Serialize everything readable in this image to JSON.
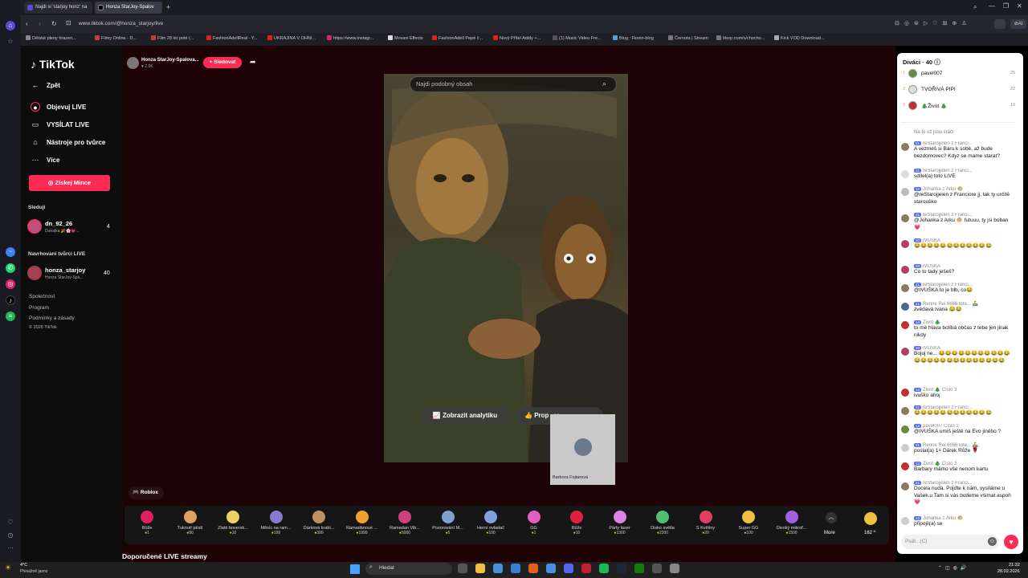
{
  "browser": {
    "tabs": [
      {
        "label": "Najdi si 'starjoy honz' na"
      },
      {
        "label": "Honza StarJoy-Spalov"
      }
    ],
    "url": "www.tiktok.com/@honza_starjoy/live",
    "bookmarks": [
      "Dětské pleny hrazen...",
      "Filmy Online - D...",
      "Film 28 let poté (...",
      "FashionAdellReal - Y...",
      "UKRAJINA V OHNI...",
      "https://www.instagr...",
      "Movavi Effects",
      "FashionAdell Pepé č...",
      "Nový Přítel Adély +...",
      "(1) Music Video Fre...",
      "Blog : Fionin-blog",
      "Černota | Stream",
      "blerp.com/s/chocho...",
      "Kick VOD Download..."
    ]
  },
  "nav": {
    "logo": "TikTok",
    "back": "Zpět",
    "items": [
      "Objevuj LIVE",
      "VYSÍLAT LIVE",
      "Nástroje pro tvůrce",
      "Více"
    ],
    "coins_button": "Získej Mince",
    "following_title": "Sleduji",
    "following": {
      "name": "dn_92_26",
      "sub": "Dunajka 🎉🌸💗...",
      "count": "4"
    },
    "suggested_title": "Navrhovaní tvůrci LIVE",
    "suggested": {
      "name": "honza_starjoy",
      "sub": "Honza StarJoy-Spa...",
      "count": "40"
    },
    "footer": [
      "Společnost",
      "Program",
      "Podmínky a zásady",
      "© 2026 TikTok"
    ]
  },
  "stream": {
    "host": "Honza StarJoy-Spalova...",
    "likes": "2.5K",
    "follow": "+ Sledovat",
    "search_placeholder": "Najdi podobný obsah",
    "analytics": "Zobrazit analytiku",
    "prop": "Prop",
    "prop_count": "14",
    "cam_name": "Barbora Fojtarová",
    "category": "Roblox"
  },
  "gifts": [
    {
      "name": "Růže",
      "price": "1",
      "color": "#e02060"
    },
    {
      "name": "Ťuknutí pěstí",
      "price": "90",
      "color": "#e0a060"
    },
    {
      "name": "Zlaté boxersk...",
      "price": "10",
      "color": "#f0d060"
    },
    {
      "name": "Měsíc na ram...",
      "price": "199",
      "color": "#8a7ad0"
    },
    {
      "name": "Dárková krabi...",
      "price": "399",
      "color": "#c09060"
    },
    {
      "name": "Ramadánové ...",
      "price": "1999",
      "color": "#f0a030"
    },
    {
      "name": "Ramadan Vib...",
      "price": "5000",
      "color": "#d04080"
    },
    {
      "name": "Pozorování M...",
      "price": "5",
      "color": "#80a0d0"
    },
    {
      "name": "Herní ovladač",
      "price": "100",
      "color": "#80a0e0"
    },
    {
      "name": "GG",
      "price": "1",
      "color": "#e060c0"
    },
    {
      "name": "Růže",
      "price": "10",
      "color": "#e02040"
    },
    {
      "name": "Párty laser",
      "price": "1300",
      "color": "#e080e0"
    },
    {
      "name": "Disko světla",
      "price": "2200",
      "color": "#50c070"
    },
    {
      "name": "S Květiny",
      "price": "20",
      "color": "#e04060"
    },
    {
      "name": "Super GG",
      "price": "100",
      "color": "#f0c040"
    },
    {
      "name": "Divoký mikrof...",
      "price": "1500",
      "color": "#a060e0"
    }
  ],
  "gifts_more": "More",
  "coin_balance": "162",
  "recommended_title": "Doporučené LIVE streamy",
  "chat": {
    "viewers_title": "Diváci · 40",
    "top_viewers": [
      {
        "rank": "1",
        "name": "pavel007",
        "count": "25"
      },
      {
        "rank": "2",
        "name": "TVOŘIVÁ PIPI",
        "count": "22"
      },
      {
        "rank": "3",
        "name": "🎄Život 🎄",
        "count": "10"
      }
    ],
    "messages": [
      {
        "user": "",
        "text": "Na to už jsou sráči"
      },
      {
        "user": "reStarojjelen z Franci...",
        "badge": "21",
        "text": "A vezmeš si Báru k sobě, až bude bezdomovec? Kdyz se mame starat?"
      },
      {
        "user": "reStarojjelen z Franci...",
        "badge": "21",
        "text": "sdílel(a) toto LIVE"
      },
      {
        "user": "Johanka z Arku 🐵",
        "badge": "13",
        "text": "@reStarojjelen z Franciore jj, tak ty určitě starouško"
      },
      {
        "user": "reStarojjelen z Franci...",
        "badge": "21",
        "text": "@Johanka z Arku 🐵 futuuu, ty jsi boban 💗"
      },
      {
        "user": "IVUŠKA",
        "badge": "20",
        "text": "😂😂😂😂😂😂😂😂😂😂😂😂"
      },
      {
        "user": "IVUŠKA",
        "badge": "20",
        "text": "Co to tady ješeš?"
      },
      {
        "user": "reStarojjelen z Franci...",
        "badge": "21",
        "text": "@IVUŠKA to je blb, co😂"
      },
      {
        "user": "Renne Rei 6666 tote... 🚣",
        "badge": "21",
        "text": "zvědavá Ivana 😂😂"
      },
      {
        "user": "Život 🎄",
        "badge": "14",
        "text": "to mě hlava bolíbá občas z tebe jen jinak nikdy"
      },
      {
        "user": "IVUŠKA",
        "badge": "20",
        "text": "Bojuj ne... 😂😂😂😂😂😂😂😂😂😂😂😂😂😂😂😂😂😂😂😂😂😂😂😂😂"
      },
      {
        "user": "Život 🎄 Číslo 3",
        "badge": "14",
        "text": "ivuško ahoj"
      },
      {
        "user": "reStarojjelen z Franci...",
        "badge": "21",
        "text": "😂😂😂😂😂😂😂😂😂😂😂😂"
      },
      {
        "user": "pavel007 Číslo 1",
        "badge": "12",
        "text": "@IVUŠKA umíš ještě na Evo jiného ?"
      },
      {
        "user": "Renne Rei 6666 tote... 🚣",
        "badge": "21",
        "text": "poslal(a) 1× Dárek Růže 🌹"
      },
      {
        "user": "Život 🎄 Číslo 3",
        "badge": "14",
        "text": "Barbary mámo vše nenom kartu"
      },
      {
        "user": "reStarojjelen z Franci...",
        "badge": "21",
        "text": "Docela nuda. Pojďte k nám, vysíláme u Vašek.u Tam si vás budeme všimat aspoň 💗"
      },
      {
        "user": "Johanka z Arku 🐵",
        "badge": "13",
        "text": "připojil(a) se"
      }
    ],
    "input_placeholder": "Psát...(C)"
  },
  "taskbar": {
    "weather_temp": "4°C",
    "weather_text": "Převážně jasno",
    "search": "Hledat",
    "time": "21:32",
    "date": "28.02.2026"
  },
  "colors": {
    "accent": "#fe2c55",
    "stage": "#1e0306",
    "chat_bg": "#ffffff"
  }
}
